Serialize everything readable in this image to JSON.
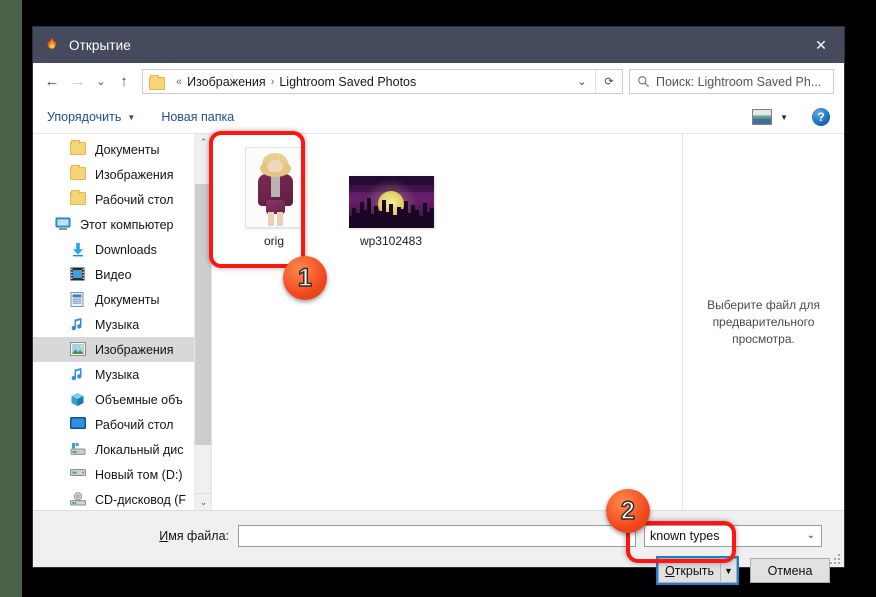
{
  "window": {
    "title": "Открытие",
    "icon": "firefox-icon",
    "close_label": "✕"
  },
  "nav": {
    "back": "←",
    "forward": "→",
    "recent": "⌄",
    "up": "↑",
    "dropdown": "⌄",
    "refresh": "⟳"
  },
  "address": {
    "folder_icon": "folder-icon",
    "overflow": "«",
    "separator": "›",
    "crumbs": [
      "Изображения",
      "Lightroom Saved Photos"
    ]
  },
  "search": {
    "icon": "search-icon",
    "placeholder": "Поиск: Lightroom Saved Ph..."
  },
  "commandbar": {
    "organize": "Упорядочить",
    "organize_caret": "▼",
    "new_folder": "Новая папка",
    "view_caret": "▼",
    "help": "?"
  },
  "sidebar": {
    "items": [
      {
        "label": "Документы",
        "icon": "folder-icon",
        "indent": 2,
        "selected": false
      },
      {
        "label": "Изображения",
        "icon": "folder-icon",
        "indent": 2,
        "selected": false
      },
      {
        "label": "Рабочий стол",
        "icon": "folder-icon",
        "indent": 2,
        "selected": false
      },
      {
        "label": "Этот компьютер",
        "icon": "this-pc-icon",
        "indent": 1,
        "selected": false
      },
      {
        "label": "Downloads",
        "icon": "downloads-icon",
        "indent": 2,
        "selected": false
      },
      {
        "label": "Видео",
        "icon": "videos-icon",
        "indent": 2,
        "selected": false
      },
      {
        "label": "Документы",
        "icon": "documents-icon",
        "indent": 2,
        "selected": false
      },
      {
        "label": "Музыка",
        "icon": "music-icon",
        "indent": 2,
        "selected": false
      },
      {
        "label": "Изображения",
        "icon": "pictures-icon",
        "indent": 2,
        "selected": true
      },
      {
        "label": "Музыка",
        "icon": "music-icon",
        "indent": 2,
        "selected": false
      },
      {
        "label": "Объемные объ",
        "icon": "3d-objects-icon",
        "indent": 2,
        "selected": false
      },
      {
        "label": "Рабочий стол",
        "icon": "desktop-icon",
        "indent": 2,
        "selected": false
      },
      {
        "label": "Локальный дис",
        "icon": "local-disk-icon",
        "indent": 2,
        "selected": false
      },
      {
        "label": "Новый том (D:)",
        "icon": "drive-icon",
        "indent": 2,
        "selected": false
      },
      {
        "label": "CD-дисковод (F",
        "icon": "cd-drive-icon",
        "indent": 2,
        "selected": false
      }
    ],
    "scroll_up": "⌃",
    "scroll_down": "⌄"
  },
  "files": [
    {
      "name": "orig",
      "thumb": "portrait-photo-thumbnail"
    },
    {
      "name": "wp3102483",
      "thumb": "cityscape-wallpaper-thumbnail"
    }
  ],
  "preview": {
    "message": "Выберите файл для предварительного просмотра."
  },
  "bottom": {
    "filename_label_first": "И",
    "filename_label_rest": "мя файла:",
    "filename_value": "",
    "filename_placeholder": "",
    "filetype_value": "known types",
    "filetype_caret": "⌄",
    "open_label_first": "О",
    "open_label_rest": "ткрыть",
    "open_caret": "▼",
    "cancel_label": "Отмена"
  },
  "annotations": [
    {
      "id": "1",
      "target": "file-item-orig"
    },
    {
      "id": "2",
      "target": "open-button"
    }
  ],
  "colors": {
    "titlebar": "#454b5c",
    "accent_blue": "#1d7fd1",
    "annotation_red": "#ff1512",
    "annotation_badge": "#f1481e",
    "selection_gray": "#d8d8d8"
  }
}
